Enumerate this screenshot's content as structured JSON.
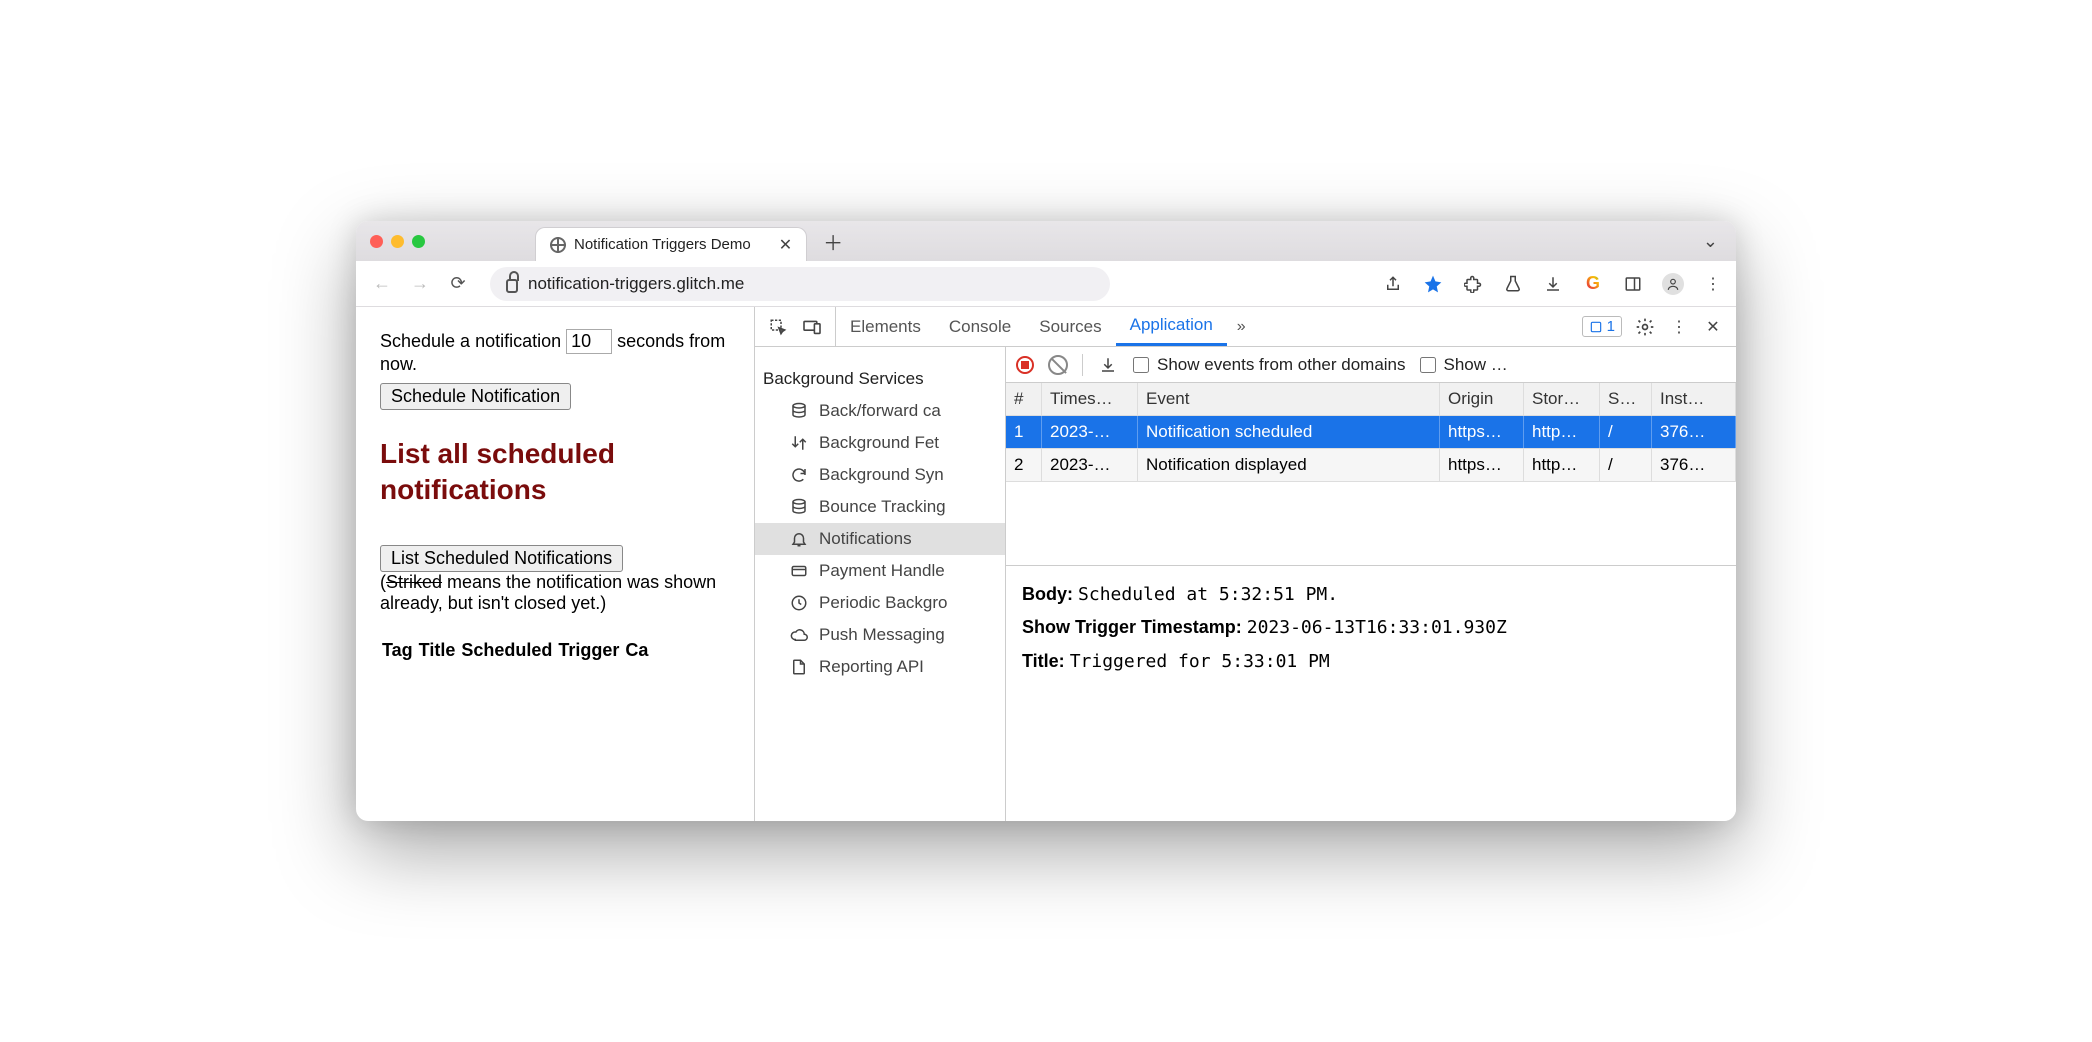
{
  "titlebar": {
    "tab_title": "Notification Triggers Demo"
  },
  "navbar": {
    "url_host": "notification-triggers.glitch.me"
  },
  "page": {
    "schedule_label_pre": "Schedule a notification ",
    "schedule_seconds": "10",
    "schedule_label_post": " seconds from now.",
    "schedule_btn": "Schedule Notification",
    "heading": "List all scheduled notifications",
    "list_btn": "List Scheduled Notifications",
    "note_open": "(",
    "note_striked": "Striked",
    "note_rest": " means the notification was shown already, but isn't closed yet.)",
    "table_headers": [
      "Tag",
      "Title",
      "Scheduled",
      "Trigger",
      "Ca"
    ]
  },
  "devtools": {
    "tabs": [
      "Elements",
      "Console",
      "Sources",
      "Application"
    ],
    "active_tab": 3,
    "issues_count": "1",
    "sidebar_title": "Background Services",
    "sidebar_items": [
      "Back/forward ca",
      "Background Fet",
      "Background Syn",
      "Bounce Tracking",
      "Notifications",
      "Payment Handle",
      "Periodic Backgro",
      "Push Messaging",
      "Reporting API"
    ],
    "sidebar_active": 4,
    "toolbar": {
      "show_from_other": "Show events from other domains",
      "show_ellipsis": "Show …"
    },
    "columns": [
      "#",
      "Times…",
      "Event",
      "Origin",
      "Stor…",
      "S…",
      "Inst…"
    ],
    "rows": [
      {
        "n": "1",
        "ts": "2023-…",
        "event": "Notification scheduled",
        "origin": "https…",
        "stor": "http…",
        "s": "/",
        "inst": "376…",
        "selected": true
      },
      {
        "n": "2",
        "ts": "2023-…",
        "event": "Notification displayed",
        "origin": "https…",
        "stor": "http…",
        "s": "/",
        "inst": "376…",
        "selected": false
      }
    ],
    "details": {
      "body_label": "Body:",
      "body_value": "Scheduled at 5:32:51 PM.",
      "trigger_label": "Show Trigger Timestamp:",
      "trigger_value": "2023-06-13T16:33:01.930Z",
      "title_label": "Title:",
      "title_value": "Triggered for 5:33:01 PM"
    }
  }
}
